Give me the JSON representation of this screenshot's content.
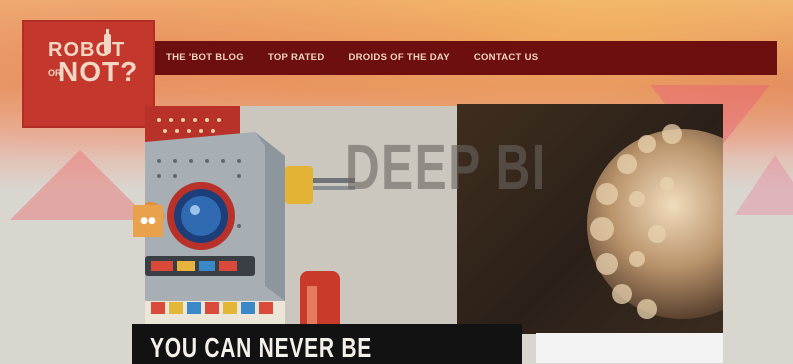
{
  "logo": {
    "line1": "ROBOT",
    "or_label": "OR",
    "line2": "NOT?"
  },
  "nav": {
    "items": [
      {
        "label": "THE 'BOT BLOG"
      },
      {
        "label": "TOP RATED"
      },
      {
        "label": "DROIDS OF THE DAY"
      },
      {
        "label": "CONTACT US"
      }
    ]
  },
  "hero": {
    "overlay_text": "DEEP BI",
    "headline": "YOU CAN NEVER BE"
  },
  "colors": {
    "logo_red": "#c4372d",
    "nav_maroon": "#6d0f0f",
    "accent_orange": "#e9a14b",
    "headline_bg": "#121212"
  },
  "icons": [
    "robot-icon",
    "sphere-icon",
    "slider-arrow-icon",
    "bottle-icon"
  ]
}
